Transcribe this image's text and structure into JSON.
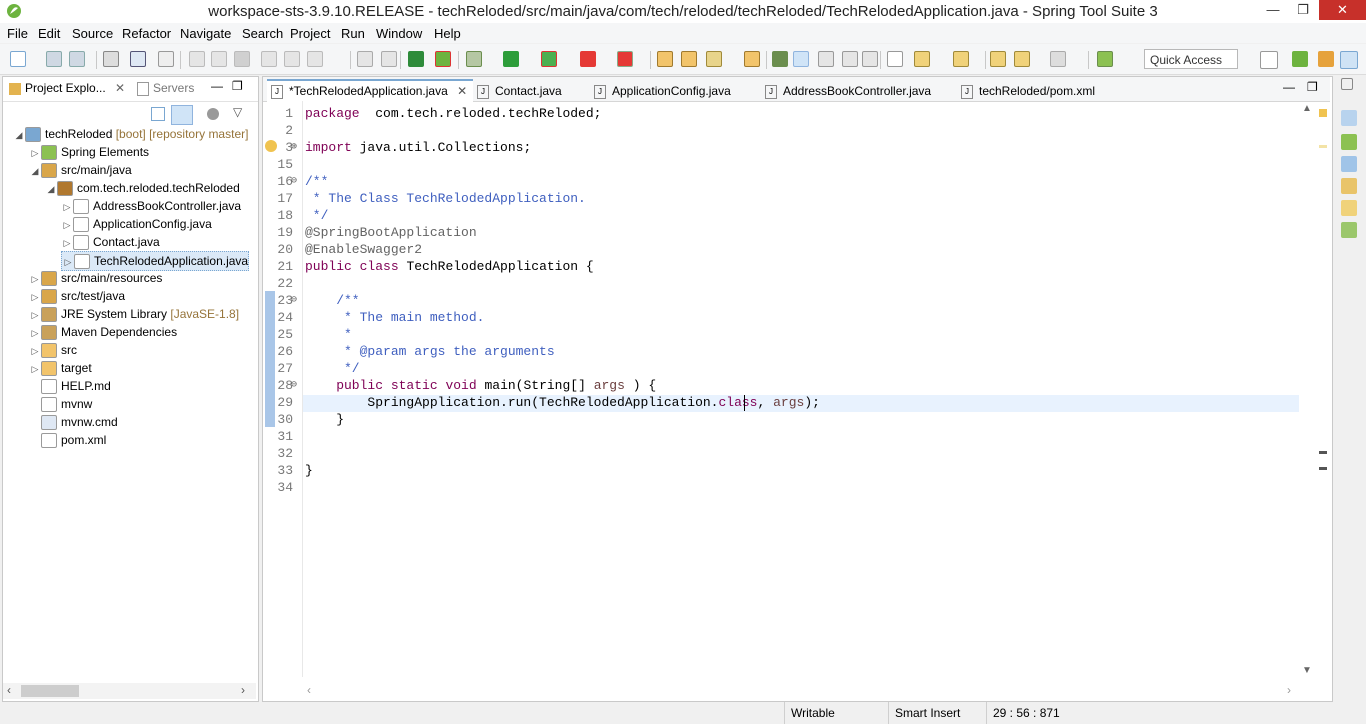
{
  "window": {
    "title": "workspace-sts-3.9.10.RELEASE - techReloded/src/main/java/com/tech/reloded/techReloded/TechRelodedApplication.java - Spring Tool Suite 3",
    "minimize": "—",
    "maximize": "❐",
    "close": "✕"
  },
  "menu": [
    "File",
    "Edit",
    "Source",
    "Refactor",
    "Navigate",
    "Search",
    "Project",
    "Run",
    "Window",
    "Help"
  ],
  "toolbar": {
    "quick_access": "Quick Access"
  },
  "left_view": {
    "tabs": [
      "Project Explo...",
      "Servers"
    ],
    "tree": [
      {
        "label": "techReloded",
        "deco": " [boot] [repository master]",
        "level": 0,
        "expanded": true,
        "icon": "project-icon"
      },
      {
        "label": "Spring Elements",
        "deco": "",
        "level": 1,
        "expanded": false,
        "icon": "spring-leaf-icon"
      },
      {
        "label": "src/main/java",
        "deco": "",
        "level": 1,
        "expanded": true,
        "icon": "source-folder-icon"
      },
      {
        "label": "com.tech.reloded.techReloded",
        "deco": "",
        "level": 2,
        "expanded": true,
        "icon": "package-icon"
      },
      {
        "label": "AddressBookController.java",
        "deco": "",
        "level": 3,
        "expanded": false,
        "icon": "java-file-icon"
      },
      {
        "label": "ApplicationConfig.java",
        "deco": "",
        "level": 3,
        "expanded": false,
        "icon": "java-file-icon"
      },
      {
        "label": "Contact.java",
        "deco": "",
        "level": 3,
        "expanded": false,
        "icon": "java-file-icon"
      },
      {
        "label": "TechRelodedApplication.java",
        "deco": "",
        "level": 3,
        "expanded": false,
        "icon": "java-file-icon",
        "selected": true
      },
      {
        "label": "src/main/resources",
        "deco": "",
        "level": 1,
        "expanded": false,
        "icon": "source-folder-icon"
      },
      {
        "label": "src/test/java",
        "deco": "",
        "level": 1,
        "expanded": false,
        "icon": "source-folder-icon"
      },
      {
        "label": "JRE System Library",
        "deco": " [JavaSE-1.8]",
        "level": 1,
        "expanded": false,
        "icon": "library-icon"
      },
      {
        "label": "Maven Dependencies",
        "deco": "",
        "level": 1,
        "expanded": false,
        "icon": "library-icon"
      },
      {
        "label": "src",
        "deco": "",
        "level": 1,
        "expanded": false,
        "icon": "folder-icon"
      },
      {
        "label": "target",
        "deco": "",
        "level": 1,
        "expanded": false,
        "icon": "folder-icon"
      },
      {
        "label": "HELP.md",
        "deco": "",
        "level": 1,
        "expanded": null,
        "icon": "markdown-file-icon"
      },
      {
        "label": "mvnw",
        "deco": "",
        "level": 1,
        "expanded": null,
        "icon": "file-icon"
      },
      {
        "label": "mvnw.cmd",
        "deco": "",
        "level": 1,
        "expanded": null,
        "icon": "cmd-file-icon"
      },
      {
        "label": "pom.xml",
        "deco": "",
        "level": 1,
        "expanded": null,
        "icon": "xml-file-icon"
      }
    ]
  },
  "editor": {
    "tabs": [
      {
        "label": "*TechRelodedApplication.java",
        "active": true,
        "closable": true
      },
      {
        "label": "Contact.java",
        "active": false
      },
      {
        "label": "ApplicationConfig.java",
        "active": false
      },
      {
        "label": "AddressBookController.java",
        "active": false
      },
      {
        "label": "techReloded/pom.xml",
        "active": false
      }
    ],
    "lines": [
      {
        "num": "1",
        "segs": [
          [
            "kw",
            "package"
          ],
          [
            "",
            "  com.tech.reloded.techReloded;"
          ]
        ]
      },
      {
        "num": "2",
        "segs": []
      },
      {
        "num": "3",
        "fold": "⊕",
        "segs": [
          [
            "kw",
            "import"
          ],
          [
            "",
            " java.util.Collections;"
          ]
        ]
      },
      {
        "num": "15",
        "segs": []
      },
      {
        "num": "16",
        "fold": "⊖",
        "segs": [
          [
            "cm",
            "/**"
          ]
        ]
      },
      {
        "num": "17",
        "segs": [
          [
            "cm",
            " * The Class TechRelodedApplication."
          ]
        ]
      },
      {
        "num": "18",
        "segs": [
          [
            "cm",
            " */"
          ]
        ]
      },
      {
        "num": "19",
        "segs": [
          [
            "an",
            "@SpringBootApplication"
          ]
        ]
      },
      {
        "num": "20",
        "segs": [
          [
            "an",
            "@EnableSwagger2"
          ]
        ]
      },
      {
        "num": "21",
        "segs": [
          [
            "kw",
            "public"
          ],
          [
            "",
            " "
          ],
          [
            "kw",
            "class"
          ],
          [
            "",
            " TechRelodedApplication {"
          ]
        ]
      },
      {
        "num": "22",
        "segs": []
      },
      {
        "num": "23",
        "fold": "⊖",
        "segs": [
          [
            "cm",
            "    /**"
          ]
        ]
      },
      {
        "num": "24",
        "segs": [
          [
            "cm",
            "     * The main method."
          ]
        ]
      },
      {
        "num": "25",
        "segs": [
          [
            "cm",
            "     *"
          ]
        ]
      },
      {
        "num": "26",
        "segs": [
          [
            "cm",
            "     * @param args the arguments"
          ]
        ]
      },
      {
        "num": "27",
        "segs": [
          [
            "cm",
            "     */"
          ]
        ]
      },
      {
        "num": "28",
        "fold": "⊖",
        "segs": [
          [
            "kw",
            "    public"
          ],
          [
            "",
            " "
          ],
          [
            "kw",
            "static"
          ],
          [
            "",
            " "
          ],
          [
            "kw",
            "void"
          ],
          [
            "",
            " main(String[] "
          ],
          [
            "pv",
            "args"
          ],
          [
            "",
            " ) {"
          ]
        ]
      },
      {
        "num": "29",
        "segs": [
          [
            "",
            "        SpringApplication.run(TechRelodedApplication."
          ],
          [
            "kw",
            "class"
          ],
          [
            "",
            ", "
          ],
          [
            "pv",
            "args"
          ],
          [
            "",
            ");"
          ]
        ]
      },
      {
        "num": "30",
        "segs": [
          [
            "",
            "    }"
          ]
        ]
      },
      {
        "num": "31",
        "segs": []
      },
      {
        "num": "32",
        "segs": []
      },
      {
        "num": "33",
        "segs": [
          [
            "",
            "}"
          ]
        ]
      },
      {
        "num": "34",
        "segs": []
      }
    ]
  },
  "statusbar": {
    "writable": "Writable",
    "insert_mode": "Smart Insert",
    "position": "29 : 56 : 871"
  }
}
